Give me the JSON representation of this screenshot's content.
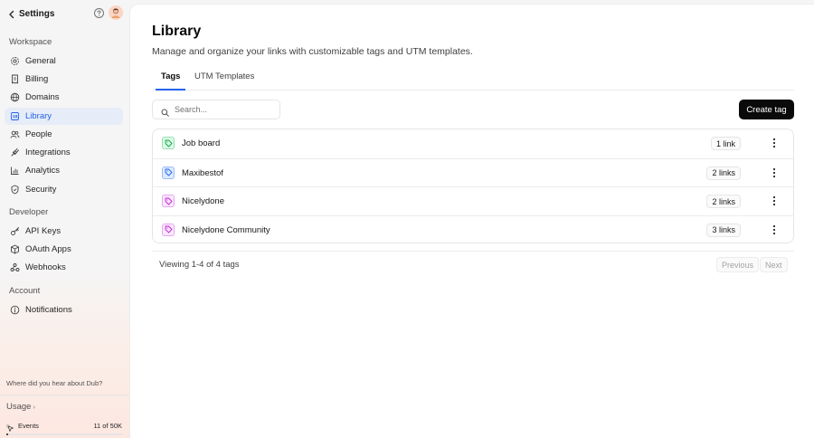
{
  "sidebar": {
    "title": "Settings",
    "back_icon": "chevron-left-icon",
    "help_icon": "help-circle-icon",
    "sections": [
      {
        "title": "Workspace",
        "items": [
          {
            "label": "General",
            "icon": "gear-icon"
          },
          {
            "label": "Billing",
            "icon": "receipt-icon"
          },
          {
            "label": "Domains",
            "icon": "globe-icon"
          },
          {
            "label": "Library",
            "icon": "library-icon",
            "active": true
          },
          {
            "label": "People",
            "icon": "users-icon"
          },
          {
            "label": "Integrations",
            "icon": "plug-icon"
          },
          {
            "label": "Analytics",
            "icon": "chart-icon"
          },
          {
            "label": "Security",
            "icon": "shield-icon"
          }
        ]
      },
      {
        "title": "Developer",
        "items": [
          {
            "label": "API Keys",
            "icon": "key-icon"
          },
          {
            "label": "OAuth Apps",
            "icon": "cube-icon"
          },
          {
            "label": "Webhooks",
            "icon": "webhook-icon"
          }
        ]
      },
      {
        "title": "Account",
        "items": [
          {
            "label": "Notifications",
            "icon": "bell-icon"
          }
        ]
      }
    ],
    "referral": "Where did you hear about Dub?",
    "usage_label": "Usage",
    "events": {
      "label": "Events",
      "count": "11 of 50K",
      "fraction": 0.0002
    }
  },
  "page": {
    "title": "Library",
    "subtitle": "Manage and organize your links with customizable tags and UTM templates."
  },
  "tabs": [
    {
      "label": "Tags",
      "active": true
    },
    {
      "label": "UTM Templates",
      "active": false
    }
  ],
  "search": {
    "placeholder": "Search...",
    "value": ""
  },
  "create_button": "Create tag",
  "tags": [
    {
      "name": "Job board",
      "links": "1 link",
      "color": "#16a34a",
      "bg": "#dcfce7"
    },
    {
      "name": "Maxibestof",
      "links": "2 links",
      "color": "#2563eb",
      "bg": "#dbeafe"
    },
    {
      "name": "Nicelydone",
      "links": "2 links",
      "color": "#c026d3",
      "bg": "#fae8ff"
    },
    {
      "name": "Nicelydone Community",
      "links": "3 links",
      "color": "#c026d3",
      "bg": "#fae8ff"
    }
  ],
  "pagination": {
    "info": "Viewing 1-4 of 4 tags",
    "previous": "Previous",
    "next": "Next"
  },
  "colors": {
    "accent": "#2563eb",
    "primary_button": "#0a0a0a"
  }
}
